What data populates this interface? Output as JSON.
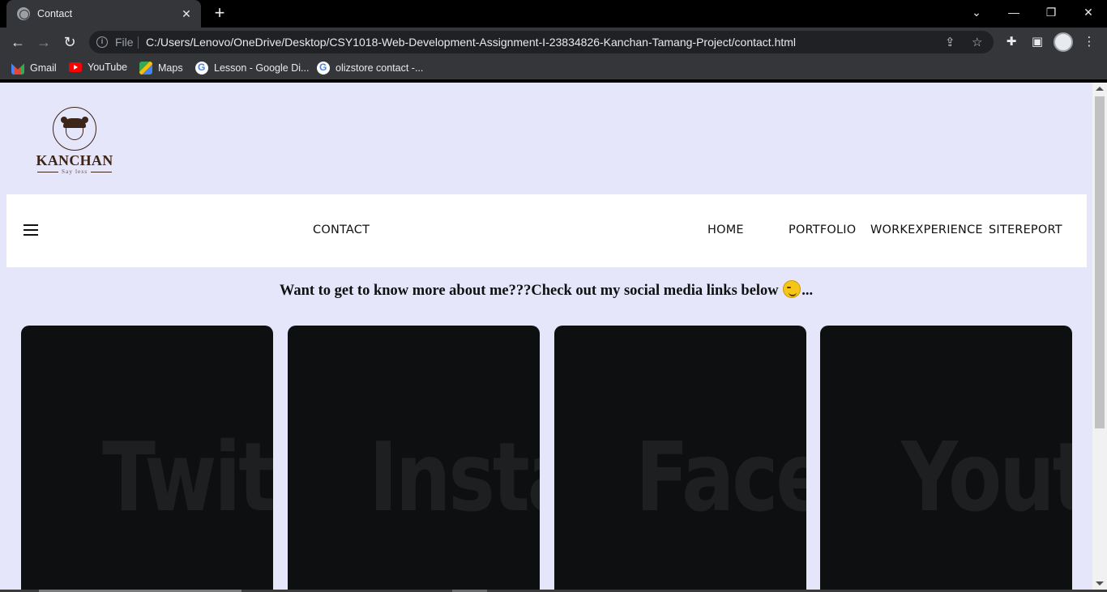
{
  "browser": {
    "tab_title": "Contact",
    "tab_close": "✕",
    "new_tab": "+",
    "file_label": "File",
    "url": "C:/Users/Lenovo/OneDrive/Desktop/CSY1018-Web-Development-Assignment-I-23834826-Kanchan-Tamang-Project/contact.html",
    "bookmarks": [
      {
        "label": "Gmail"
      },
      {
        "label": "YouTube"
      },
      {
        "label": "Maps"
      },
      {
        "label": "Lesson - Google Di..."
      },
      {
        "label": "olizstore contact -..."
      }
    ]
  },
  "page": {
    "logo": {
      "name": "KANCHAN",
      "tagline": "Say less"
    },
    "nav": {
      "current": "CONTACT",
      "items": [
        "HOME",
        "PORTFOLIO",
        "WORKEXPERIENCE",
        "SITEREPORT"
      ]
    },
    "headline_text": "Want to get to know more about me???Check out my social media links below ",
    "headline_suffix": "...",
    "cards": [
      {
        "word": "Twitter"
      },
      {
        "word": "Instagram"
      },
      {
        "word": "Facebook"
      },
      {
        "word": "Youtube"
      }
    ]
  },
  "colors": {
    "page_bg": "#e6e6fa",
    "card_bg": "#0e0f11",
    "logo_brown": "#3d2418"
  }
}
